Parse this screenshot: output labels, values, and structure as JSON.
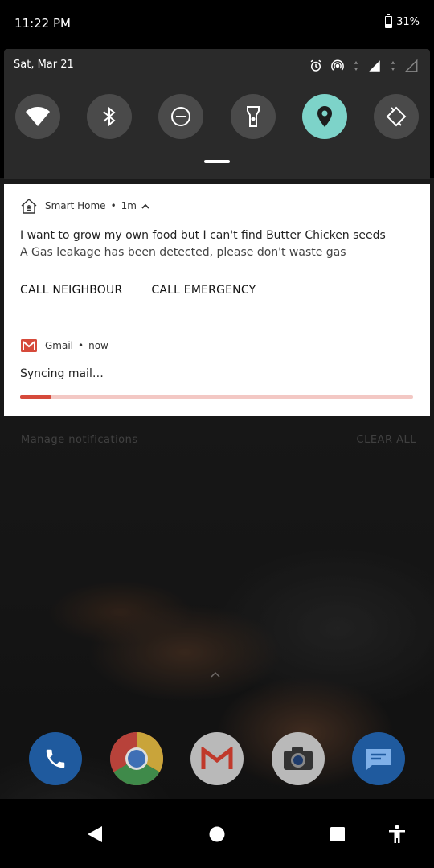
{
  "status_bar": {
    "time": "11:22 PM",
    "battery": "31%"
  },
  "quick_settings": {
    "date": "Sat, Mar 21",
    "status_icons": [
      "alarm-icon",
      "hotspot-icon",
      "signal-icon",
      "no-signal-icon"
    ],
    "tiles": [
      {
        "name": "wifi-icon",
        "active": false
      },
      {
        "name": "bluetooth-icon",
        "active": false
      },
      {
        "name": "dnd-icon",
        "active": false
      },
      {
        "name": "flashlight-icon",
        "active": false
      },
      {
        "name": "location-icon",
        "active": true
      },
      {
        "name": "auto-rotate-icon",
        "active": false
      }
    ],
    "active_color": "#7dd3c9"
  },
  "notifications": [
    {
      "app": "Smart Home",
      "time": "1m",
      "title": "I want to grow my own food but I can't find Butter Chicken seeds",
      "text": "A Gas leakage has been detected, please don't waste gas",
      "actions": [
        "CALL NEIGHBOUR",
        "CALL EMERGENCY"
      ]
    },
    {
      "app": "Gmail",
      "time": "now",
      "title": "Syncing mail…",
      "progress": 0.08,
      "accent": "#d64a3b"
    }
  ],
  "wallpaper_labels": {
    "left": "Manage notifications",
    "right": "CLEAR ALL"
  },
  "dock": [
    "phone-app-icon",
    "chrome-app-icon",
    "gmail-app-icon",
    "camera-app-icon",
    "messages-app-icon"
  ],
  "navbar": [
    "back-icon",
    "home-icon",
    "recents-icon",
    "accessibility-icon"
  ]
}
